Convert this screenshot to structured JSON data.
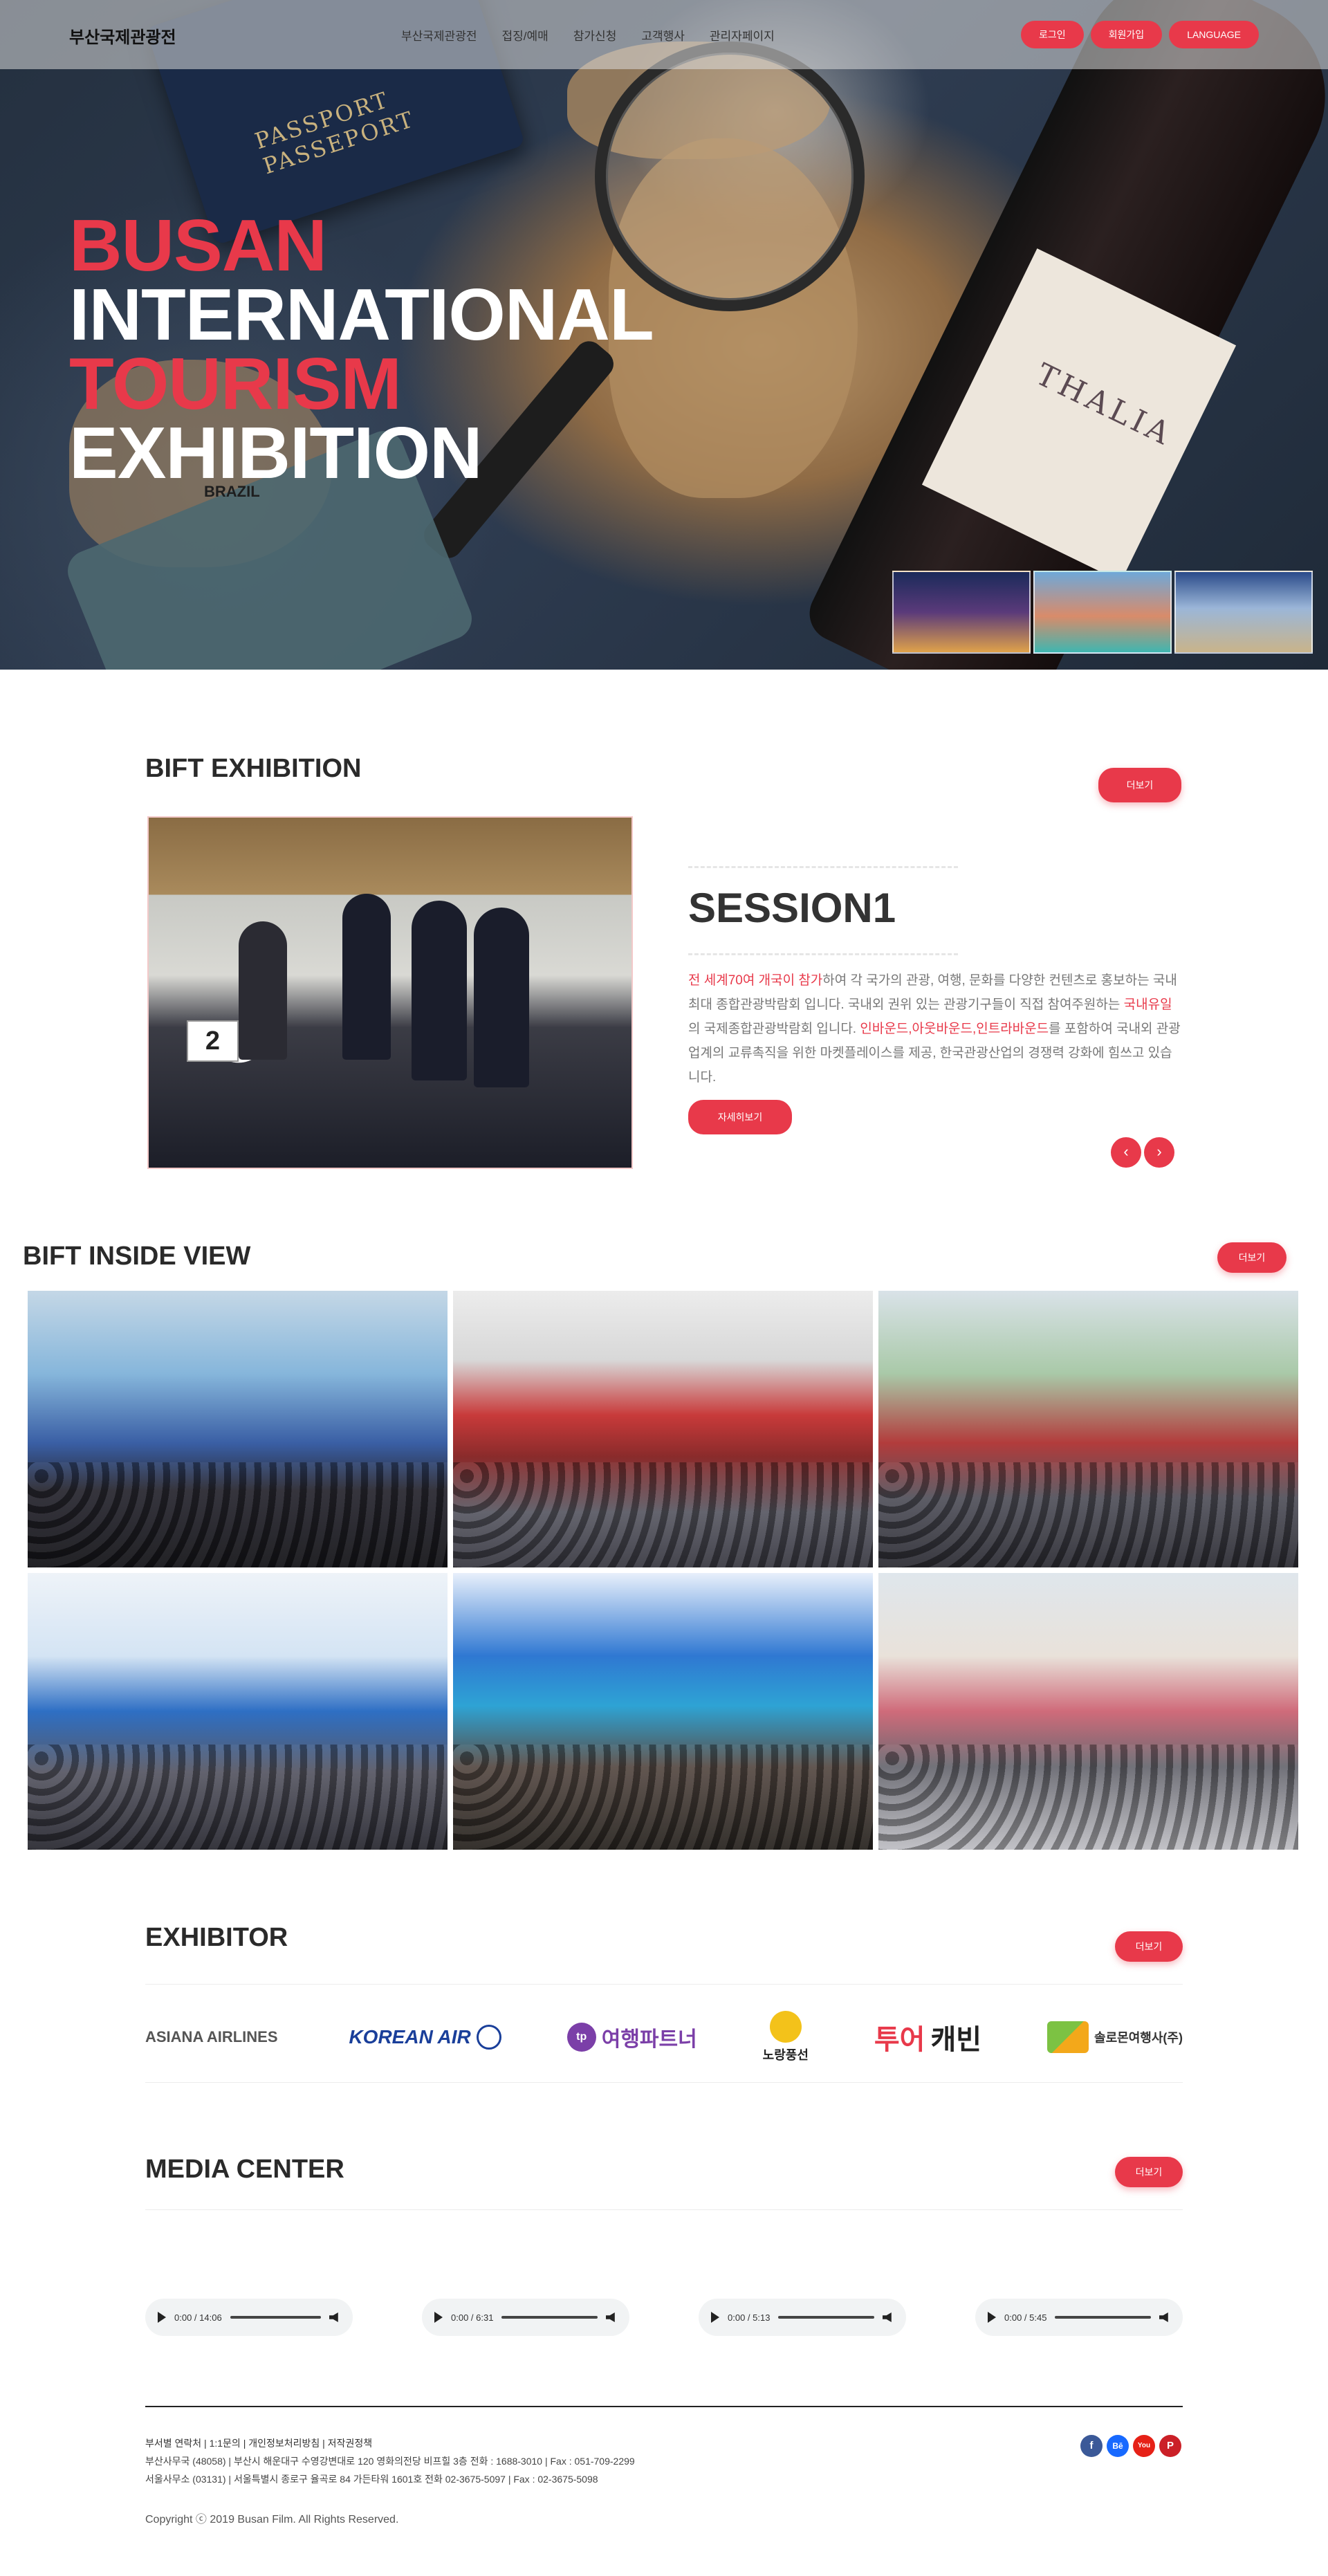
{
  "header": {
    "logo": "부산국제관광전",
    "nav": [
      "부산국제관광전",
      "접징/예매",
      "참가신청",
      "고객행사",
      "관리자페이지"
    ],
    "buttons": [
      "로그인",
      "회원가입",
      "LANGUAGE"
    ]
  },
  "hero": {
    "title_lines": [
      "BUSAN",
      "INTERNATIONAL",
      "TOURISM",
      "EXHIBITION"
    ],
    "bg_texts": {
      "passport": "PASSPORT\nPASSEPORT",
      "wine": "THALIA",
      "country": "BRAZIL"
    }
  },
  "exhibition": {
    "title": "BIFT EXHIBITION",
    "more": "더보기",
    "card_number": "2",
    "session": "SESSION1",
    "desc_red1": "전 세계70여 개국이 참가",
    "desc_1": "하여 각 국가의 관광, 여행, 문화를 다양한 컨텐츠로 홍보하는 국내최대 종합관광박람회 입니다. 국내외 권위 있는 관광기구들이 직접 참여주원하는 ",
    "desc_red2": "국내유일",
    "desc_2": "의 국제종합관광박람회 입니다. ",
    "desc_red3": "인바운드,아웃바운드,인트라바운드",
    "desc_3": "를 포함하여 국내외 관광업계의 교류촉직을 위한 마켓플레이스를 제공, 한국관광산업의 경쟁력 강화에 힘쓰고 있습니다.",
    "detail_button": "자세히보기",
    "prev_arrow": "‹",
    "next_arrow": "›"
  },
  "inside": {
    "title": "BIFT INSIDE VIEW",
    "more": "더보기"
  },
  "exhibitor": {
    "title": "EXHIBITOR",
    "more": "더보기",
    "logos": {
      "asiana": "ASIANA AIRLINES",
      "korean": "KOREAN AIR",
      "tp_mark": "tp",
      "tp_text": "여행파트너",
      "balloon": "노랑풍선",
      "tour1": "투어",
      "tour2": "캐빈",
      "solomon": "솔로몬여행사(주)"
    }
  },
  "media": {
    "title": "MEDIA CENTER",
    "more": "더보기",
    "players": [
      "0:00 / 14:06",
      "0:00 / 6:31",
      "0:00 / 5:13",
      "0:00 / 5:45"
    ]
  },
  "footer": {
    "links": "부서별 연락처 | 1:1문의 | 개인정보처리방침 | 저작권정책",
    "addr1": "부산사무국 (48058) | 부산시 해운대구 수영강변대로 120 영화의전당 비프힐 3층 전화 : 1688-3010 | Fax : 051-709-2299",
    "addr2": "서울사무소 (03131) | 서울특별시 종로구 율곡로 84 가든타워 1601호 전화 02-3675-5097 | Fax : 02-3675-5098",
    "copyright": "Copyright ⓒ 2019 Busan Film. All Rights Reserved.",
    "social": [
      "f",
      "Bē",
      "You",
      "P"
    ]
  },
  "colors": {
    "accent": "#e8394a"
  }
}
